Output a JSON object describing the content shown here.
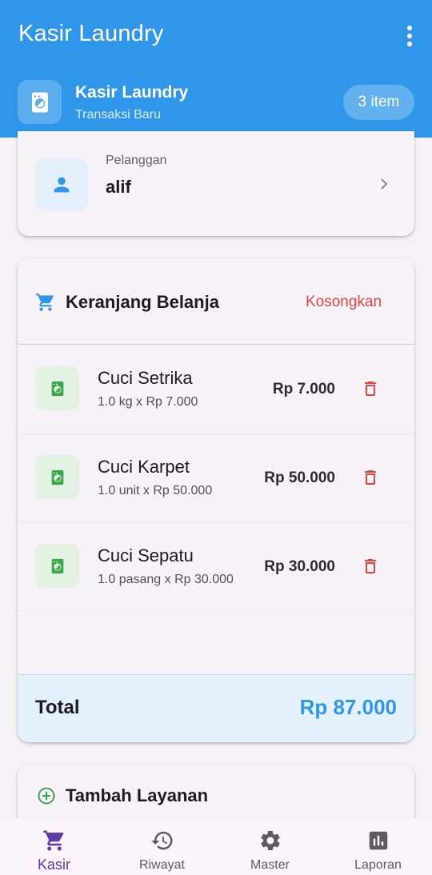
{
  "app_bar": {
    "title": "Kasir Laundry",
    "menu_icon": "more-vert-icon"
  },
  "header": {
    "icon": "washing-machine-icon",
    "title": "Kasir Laundry",
    "subtitle": "Transaksi Baru",
    "item_count": "3 item"
  },
  "customer": {
    "icon": "person-icon",
    "label": "Pelanggan",
    "name": "alif"
  },
  "cart": {
    "icon": "shopping-cart-icon",
    "title": "Keranjang Belanja",
    "clear_label": "Kosongkan",
    "items": [
      {
        "name": "Cuci Setrika",
        "detail": "1.0 kg x Rp 7.000",
        "price": "Rp 7.000"
      },
      {
        "name": "Cuci Karpet",
        "detail": "1.0 unit x Rp 50.000",
        "price": "Rp 50.000"
      },
      {
        "name": "Cuci Sepatu",
        "detail": "1.0 pasang x Rp 30.000",
        "price": "Rp 30.000"
      }
    ],
    "total_label": "Total",
    "total_value": "Rp 87.000"
  },
  "add_service": {
    "icon": "add-circle-icon",
    "label": "Tambah Layanan"
  },
  "bottom_nav": {
    "items": [
      {
        "label": "Kasir",
        "icon": "shopping-cart-icon",
        "active": true
      },
      {
        "label": "Riwayat",
        "icon": "history-icon",
        "active": false
      },
      {
        "label": "Master",
        "icon": "settings-icon",
        "active": false
      },
      {
        "label": "Laporan",
        "icon": "chart-icon",
        "active": false
      }
    ]
  },
  "colors": {
    "primary": "#2f96ea",
    "danger": "#e0463c",
    "success": "#3aa84a",
    "nav_active": "#5b3ca9"
  }
}
